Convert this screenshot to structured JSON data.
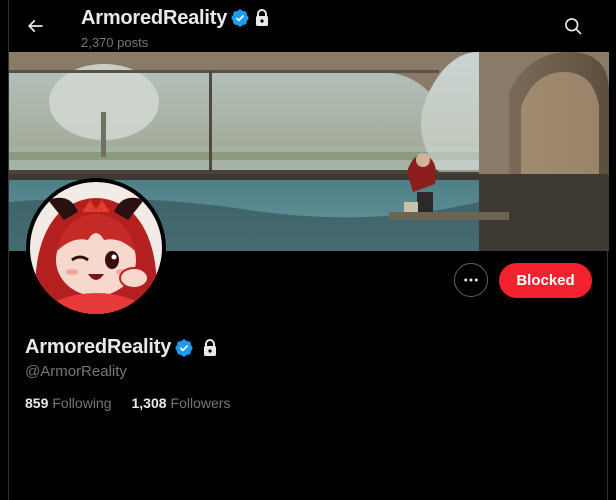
{
  "header": {
    "title": "ArmoredReality",
    "posts_count": "2,370 posts",
    "back_icon": "arrow-left-icon",
    "search_icon": "search-icon"
  },
  "profile": {
    "display_name": "ArmoredReality",
    "handle": "@ArmorReality",
    "verified": true,
    "protected": true,
    "following_count": "859",
    "following_label": "Following",
    "followers_count": "1,308",
    "followers_label": "Followers"
  },
  "actions": {
    "more_icon": "more-dots-icon",
    "blocked_label": "Blocked"
  },
  "colors": {
    "background": "#000000",
    "verified_blue": "#1d9bf0",
    "blocked_red": "#f4212e",
    "secondary_text": "#71767b",
    "primary_text": "#e7e9ea"
  }
}
